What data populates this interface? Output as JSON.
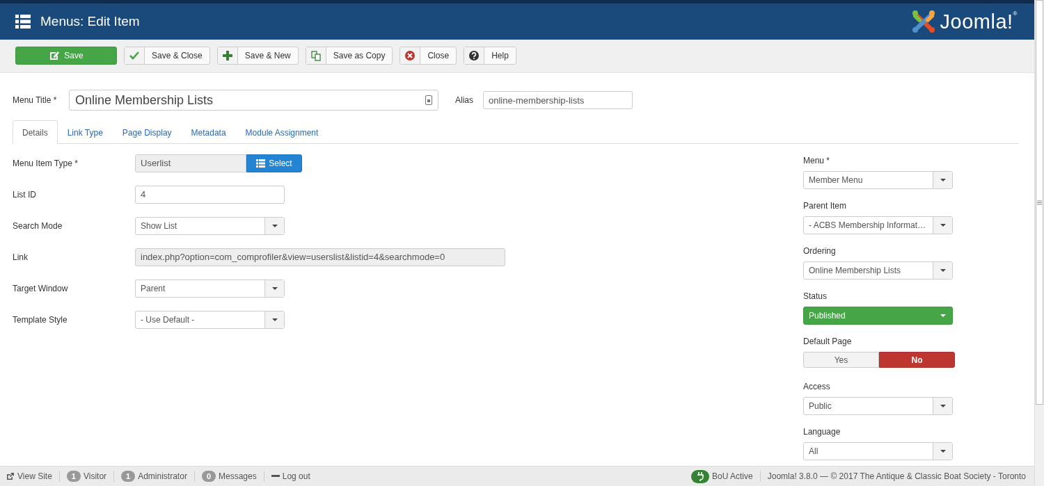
{
  "header": {
    "title": "Menus: Edit Item",
    "logo": "Joomla!$^{®}$"
  },
  "toolbar": [
    {
      "label": "Save",
      "kind": "primary"
    },
    {
      "label": "Save & Close",
      "kind": "default"
    },
    {
      "label": "Save & New",
      "kind": "default"
    },
    {
      "label": "Save as Copy",
      "kind": "default"
    },
    {
      "label": "Close",
      "kind": "default"
    },
    {
      "label": "Help",
      "kind": "default"
    }
  ],
  "title_row": {
    "label": "Menu Title *",
    "value": "Online Membership Lists",
    "alias_label": "Alias",
    "alias_value": "online-membership-lists"
  },
  "tabs": [
    {
      "label": "Details",
      "selected": true
    },
    {
      "label": "Link Type",
      "selected": false
    },
    {
      "label": "Page Display",
      "selected": false
    },
    {
      "label": "Metadata",
      "selected": false
    },
    {
      "label": "Module Assignment",
      "selected": false
    }
  ],
  "details": [
    {
      "label": "Menu Item Type *",
      "kind": "type-picker",
      "value": "Userlist",
      "button": "Select"
    },
    {
      "label": "List ID",
      "kind": "text",
      "value": "4"
    },
    {
      "label": "Search Mode",
      "kind": "select",
      "value": "Show List"
    },
    {
      "label": "Link",
      "kind": "readonly",
      "value": "index.php?option=com_comprofiler&view=userslist&listid=4&searchmode=0"
    },
    {
      "label": "Target Window",
      "kind": "select",
      "value": "Parent"
    },
    {
      "label": "Template Style",
      "kind": "select",
      "value": "- Use Default -"
    }
  ],
  "side": [
    {
      "label": "Menu *",
      "kind": "select",
      "value": "Member Menu"
    },
    {
      "label": "Parent Item",
      "kind": "select",
      "value": "- ACBS Membership Informat…"
    },
    {
      "label": "Ordering",
      "kind": "select",
      "value": "Online Membership Lists"
    },
    {
      "label": "Status",
      "kind": "status",
      "value": "Published"
    },
    {
      "label": "Default Page",
      "kind": "toggle",
      "options": [
        {
          "label": "Yes",
          "selected": false
        },
        {
          "label": "No",
          "selected": true
        }
      ]
    },
    {
      "label": "Access",
      "kind": "select",
      "value": "Public"
    },
    {
      "label": "Language",
      "kind": "select",
      "value": "All"
    }
  ],
  "status_bar": {
    "left": [
      {
        "kind": "link",
        "label": "View Site"
      },
      {
        "kind": "count",
        "count": "1",
        "label": "Visitor"
      },
      {
        "kind": "count",
        "count": "1",
        "label": "Administrator"
      },
      {
        "kind": "count",
        "count": "0",
        "label": "Messages"
      },
      {
        "kind": "logout",
        "label": "Log out"
      }
    ],
    "right": [
      {
        "kind": "badge",
        "label": "BoU Active"
      },
      {
        "kind": "text",
        "label": "Joomla! 3.8.0 — © 2017 The Antique & Classic Boat Society - Toronto"
      }
    ]
  }
}
